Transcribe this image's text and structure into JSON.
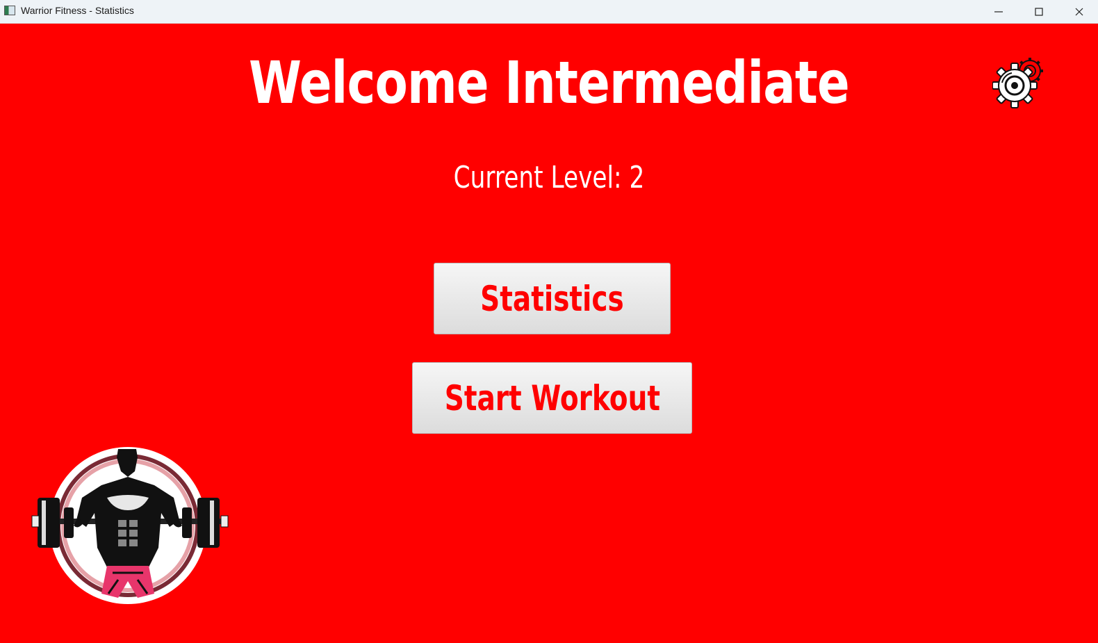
{
  "window": {
    "title": "Warrior Fitness - Statistics",
    "controls": {
      "minimize": "minimize",
      "maximize": "maximize",
      "close": "close"
    }
  },
  "main": {
    "headline": "Welcome Intermediate",
    "level_text": "Current Level: 2",
    "settings_icon": "gear-icon",
    "buttons": {
      "statistics": "Statistics",
      "start_workout": "Start Workout"
    },
    "logo_icon": "bodybuilder-barbell-logo"
  },
  "colors": {
    "background": "#ff0000",
    "text": "#ffffff",
    "button_text": "#ff0000",
    "button_face": "#e6e6e6"
  }
}
